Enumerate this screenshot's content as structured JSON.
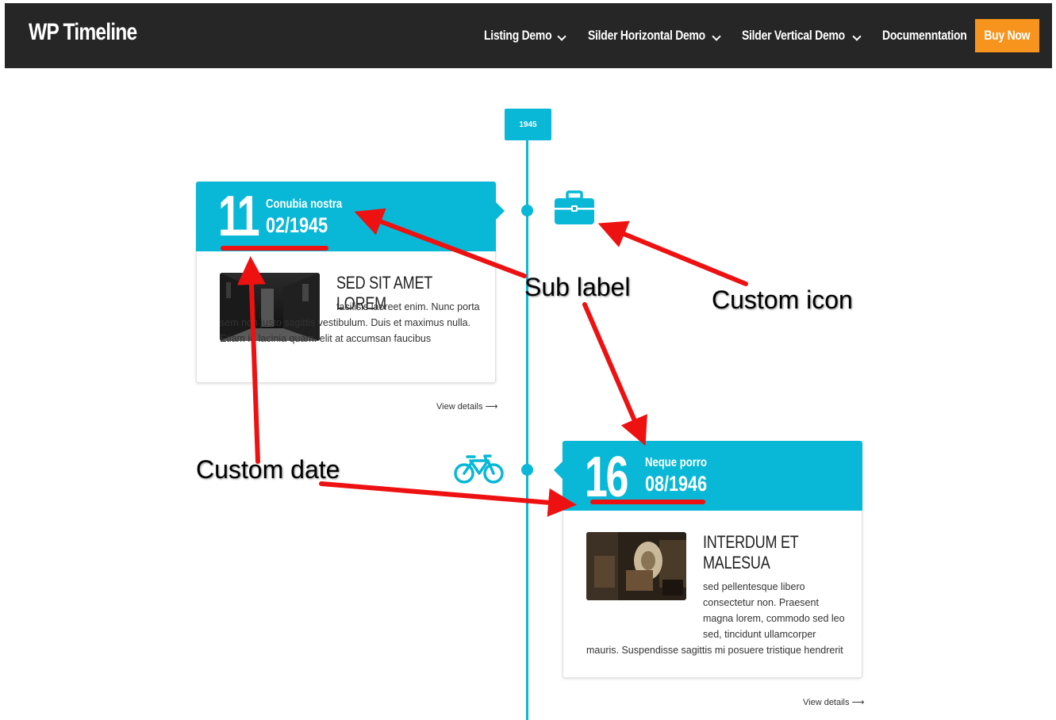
{
  "header": {
    "logo": "WP Timeline",
    "nav": [
      {
        "label": "Listing Demo",
        "has_dropdown": true
      },
      {
        "label": "Silder Horizontal Demo",
        "has_dropdown": true
      },
      {
        "label": "Silder Vertical Demo",
        "has_dropdown": true
      },
      {
        "label": "Documenntation",
        "has_dropdown": false
      }
    ],
    "buy_label": "Buy Now"
  },
  "timeline": {
    "year": "1945",
    "items": [
      {
        "day": "11",
        "sub_label": "Conubia nostra",
        "date": "02/1945",
        "icon": "briefcase-icon",
        "title": "SED SIT AMET LOREM",
        "text": "facilisis laoreet enim. Nunc porta sem non justo sagittis vestibulum. Duis et maximus nulla. Etiam id lacinia quam. elit at accumsan faucibus",
        "link": "View details"
      },
      {
        "day": "16",
        "sub_label": "Neque porro",
        "date": "08/1946",
        "icon": "bicycle-icon",
        "title": "INTERDUM ET MALESUA",
        "text": "sed pellentesque libero consectetur non. Praesent magna lorem, commodo sed leo sed, tincidunt ullamcorper mauris. Suspendisse sagittis mi posuere tristique hendrerit",
        "link": "View details"
      }
    ]
  },
  "annotations": {
    "sub_label": "Sub label",
    "custom_icon": "Custom icon",
    "custom_date": "Custom date"
  },
  "colors": {
    "accent": "#08b8d6",
    "header_bg": "#262626",
    "buy_button": "#f7941d",
    "annotation_arrow": "#ee1111"
  }
}
